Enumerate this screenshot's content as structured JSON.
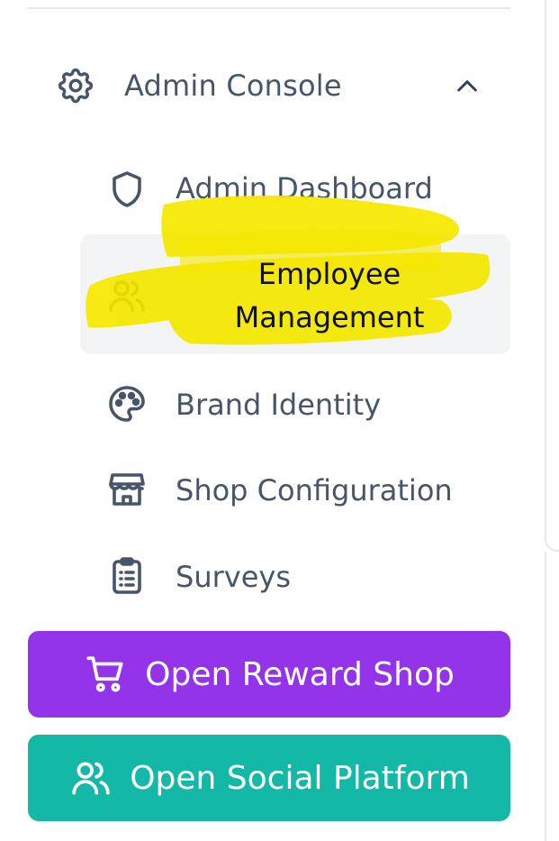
{
  "colors": {
    "text": "#475569",
    "active_bg": "#f3f4f6",
    "highlight": "#f5e800",
    "reward_button": "#9333ea",
    "social_button": "#14b8a6"
  },
  "admin_console": {
    "label": "Admin Console",
    "icon": "gear-icon",
    "expanded": true
  },
  "nav_items": [
    {
      "label": "Admin Dashboard",
      "icon": "shield-icon"
    },
    {
      "label": "Employee Management",
      "icon": "users-icon",
      "active": true
    },
    {
      "label": "Brand Identity",
      "icon": "palette-icon"
    },
    {
      "label": "Shop Configuration",
      "icon": "store-icon"
    },
    {
      "label": "Surveys",
      "icon": "clipboard-icon"
    }
  ],
  "buttons": {
    "reward_shop": {
      "label": "Open Reward Shop",
      "icon": "cart-icon"
    },
    "social_platform": {
      "label": "Open Social Platform",
      "icon": "users-icon"
    }
  }
}
